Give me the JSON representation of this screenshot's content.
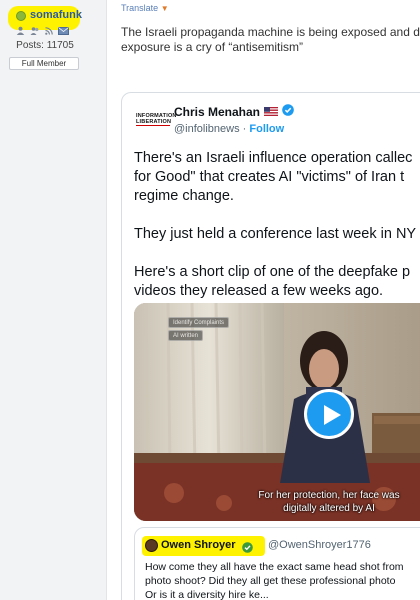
{
  "user": {
    "name": "somafunk",
    "posts": "Posts: 11705",
    "rank": "Full Member",
    "colors": {
      "highlight": "#fff200",
      "online": "#8bb83a",
      "name": "#2b5aa6"
    }
  },
  "post": {
    "translate_label": "Translate",
    "text_lines": [
      "The Israeli propaganda machine is being exposed and d",
      "exposure is a cry of “antisemitism”"
    ]
  },
  "tweet": {
    "avatar_lines": [
      "INFORMATION",
      "LIBERATION"
    ],
    "author": "Chris Menahan",
    "flag_icon": "us-flag-icon",
    "handle": "@infolibnews",
    "separator": " · ",
    "follow_label": "Follow",
    "body_paragraphs": [
      [
        "There's an Israeli influence operation callec",
        "for Good\" that creates AI \"victims\" of Iran t",
        "regime change."
      ],
      [
        "They just held a conference last week in NY"
      ],
      [
        "Here's a short clip of one of the deepfake p",
        "videos they released a few weeks ago."
      ]
    ],
    "video": {
      "badge_1": "Identify Complaints",
      "badge_2": "AI written",
      "caption_lines": [
        "For her protection, her face was",
        "digitally altered by AI"
      ]
    },
    "quote": {
      "author": "Owen Shroyer",
      "handle": "@OwenShroyer1776",
      "text_lines": [
        "How come they all have the exact same head shot from",
        "photo shoot? Did they all get these professional photo",
        "Or is it a diversity hire ke..."
      ]
    },
    "colors": {
      "accent": "#1d9bf0",
      "verified_gold": "#d4a017"
    }
  }
}
